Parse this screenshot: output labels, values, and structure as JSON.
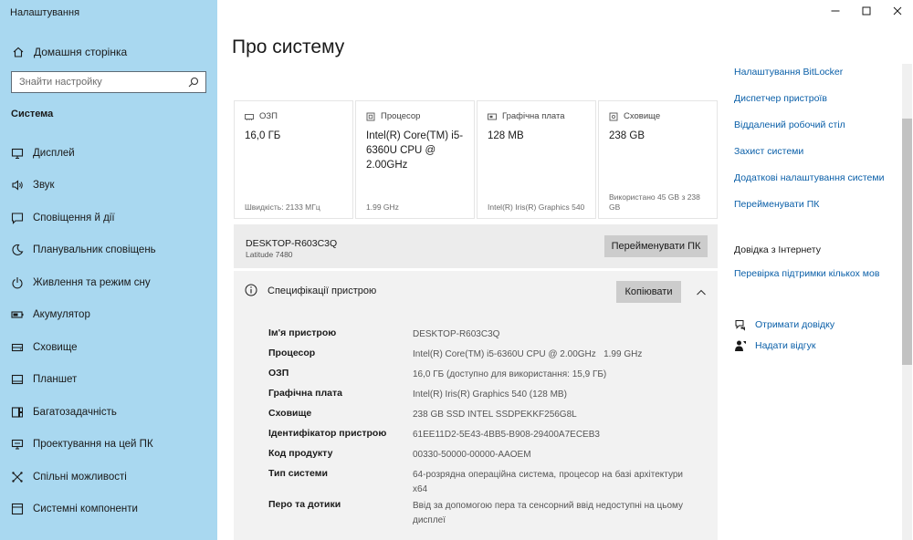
{
  "app": {
    "title": "Налаштування"
  },
  "sidebar": {
    "home_label": "Домашня сторінка",
    "search_placeholder": "Знайти настройку",
    "section_label": "Система",
    "items": [
      {
        "label": "Дисплей",
        "icon": "monitor-icon"
      },
      {
        "label": "Звук",
        "icon": "speaker-icon"
      },
      {
        "label": "Сповіщення й дії",
        "icon": "notification-icon"
      },
      {
        "label": "Планувальник сповіщень",
        "icon": "moon-icon"
      },
      {
        "label": "Живлення та режим сну",
        "icon": "power-icon"
      },
      {
        "label": "Акумулятор",
        "icon": "battery-icon"
      },
      {
        "label": "Сховище",
        "icon": "storage-icon"
      },
      {
        "label": "Планшет",
        "icon": "tablet-icon"
      },
      {
        "label": "Багатозадачність",
        "icon": "multitask-icon"
      },
      {
        "label": "Проектування на цей ПК",
        "icon": "project-icon"
      },
      {
        "label": "Спільні можливості",
        "icon": "shared-icon"
      },
      {
        "label": "Системні компоненти",
        "icon": "components-icon"
      }
    ]
  },
  "main": {
    "title": "Про систему",
    "cards": [
      {
        "label": "ОЗП",
        "value": "16,0 ГБ",
        "sub": "Швидкість: 2133 МГц",
        "icon": "ram-icon"
      },
      {
        "label": "Процесор",
        "value": "Intel(R) Core(TM) i5-6360U CPU @ 2.00GHz",
        "sub": "1.99 GHz",
        "icon": "cpu-icon"
      },
      {
        "label": "Графічна плата",
        "value": "128 MB",
        "sub": "Intel(R) Iris(R) Graphics 540",
        "icon": "gpu-icon"
      },
      {
        "label": "Сховище",
        "value": "238 GB",
        "sub": "Використано 45 GB з 238 GB",
        "icon": "disk-icon"
      }
    ],
    "device": {
      "name": "DESKTOP-R603C3Q",
      "model": "Latitude 7480",
      "rename_label": "Перейменувати ПК"
    },
    "specs": {
      "title": "Специфікації пристрою",
      "copy_label": "Копіювати",
      "rows": [
        {
          "key": "Ім'я пристрою",
          "value": "DESKTOP-R603C3Q"
        },
        {
          "key": "Процесор",
          "value": "Intel(R) Core(TM) i5-6360U CPU @ 2.00GHz   1.99 GHz"
        },
        {
          "key": "ОЗП",
          "value": "16,0 ГБ (доступно для використання: 15,9 ГБ)"
        },
        {
          "key": "Графічна плата",
          "value": "Intel(R) Iris(R) Graphics 540 (128 MB)"
        },
        {
          "key": "Сховище",
          "value": "238 GB SSD INTEL SSDPEKKF256G8L"
        },
        {
          "key": "Ідентифікатор пристрою",
          "value": "61EE11D2-5E43-4BB5-B908-29400A7ECEB3"
        },
        {
          "key": "Код продукту",
          "value": "00330-50000-00000-AAOEM"
        },
        {
          "key": "Тип системи",
          "value": "64-розрядна операційна система, процесор на базі архітектури x64"
        },
        {
          "key": "Перо та дотики",
          "value": "Ввід за допомогою пера та сенсорний ввід недоступні на цьому дисплеї"
        }
      ]
    }
  },
  "right": {
    "links": [
      "Налаштування BitLocker",
      "Диспетчер пристроїв",
      "Віддалений робочий стіл",
      "Захист системи",
      "Додаткові налаштування системи",
      "Перейменувати ПК"
    ],
    "help_heading": "Довідка з Інтернету",
    "help_link": "Перевірка підтримки кількох мов",
    "get_help": "Отримати довідку",
    "feedback": "Надати відгук"
  },
  "colors": {
    "sidebar_bg": "#a9d8f0",
    "link": "#0a5fa8",
    "button": "#cccccc",
    "panel": "#f2f2f2"
  }
}
